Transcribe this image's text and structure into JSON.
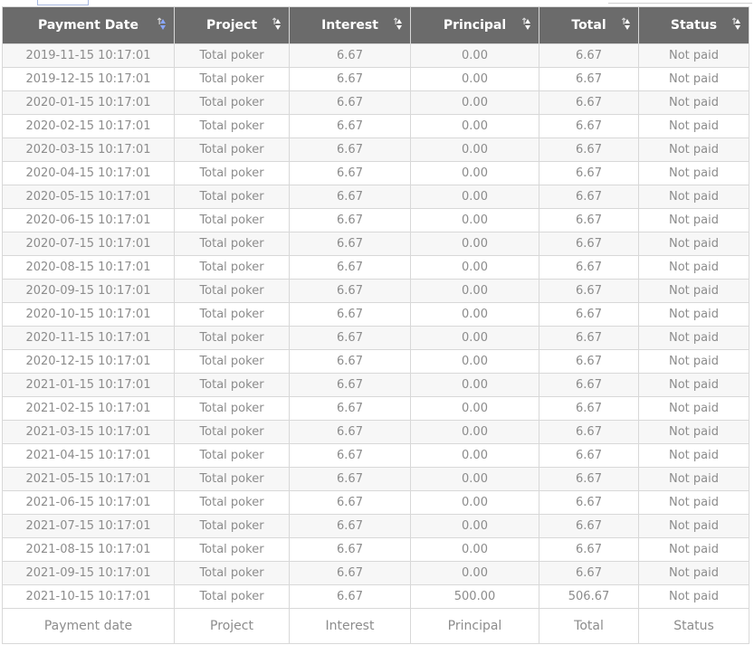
{
  "columns": [
    {
      "label": "Payment Date",
      "sort_active": true
    },
    {
      "label": "Project",
      "sort_active": false
    },
    {
      "label": "Interest",
      "sort_active": false
    },
    {
      "label": "Principal",
      "sort_active": false
    },
    {
      "label": "Total",
      "sort_active": false
    },
    {
      "label": "Status",
      "sort_active": false
    }
  ],
  "rows": [
    [
      "2019-11-15 10:17:01",
      "Total poker",
      "6.67",
      "0.00",
      "6.67",
      "Not paid"
    ],
    [
      "2019-12-15 10:17:01",
      "Total poker",
      "6.67",
      "0.00",
      "6.67",
      "Not paid"
    ],
    [
      "2020-01-15 10:17:01",
      "Total poker",
      "6.67",
      "0.00",
      "6.67",
      "Not paid"
    ],
    [
      "2020-02-15 10:17:01",
      "Total poker",
      "6.67",
      "0.00",
      "6.67",
      "Not paid"
    ],
    [
      "2020-03-15 10:17:01",
      "Total poker",
      "6.67",
      "0.00",
      "6.67",
      "Not paid"
    ],
    [
      "2020-04-15 10:17:01",
      "Total poker",
      "6.67",
      "0.00",
      "6.67",
      "Not paid"
    ],
    [
      "2020-05-15 10:17:01",
      "Total poker",
      "6.67",
      "0.00",
      "6.67",
      "Not paid"
    ],
    [
      "2020-06-15 10:17:01",
      "Total poker",
      "6.67",
      "0.00",
      "6.67",
      "Not paid"
    ],
    [
      "2020-07-15 10:17:01",
      "Total poker",
      "6.67",
      "0.00",
      "6.67",
      "Not paid"
    ],
    [
      "2020-08-15 10:17:01",
      "Total poker",
      "6.67",
      "0.00",
      "6.67",
      "Not paid"
    ],
    [
      "2020-09-15 10:17:01",
      "Total poker",
      "6.67",
      "0.00",
      "6.67",
      "Not paid"
    ],
    [
      "2020-10-15 10:17:01",
      "Total poker",
      "6.67",
      "0.00",
      "6.67",
      "Not paid"
    ],
    [
      "2020-11-15 10:17:01",
      "Total poker",
      "6.67",
      "0.00",
      "6.67",
      "Not paid"
    ],
    [
      "2020-12-15 10:17:01",
      "Total poker",
      "6.67",
      "0.00",
      "6.67",
      "Not paid"
    ],
    [
      "2021-01-15 10:17:01",
      "Total poker",
      "6.67",
      "0.00",
      "6.67",
      "Not paid"
    ],
    [
      "2021-02-15 10:17:01",
      "Total poker",
      "6.67",
      "0.00",
      "6.67",
      "Not paid"
    ],
    [
      "2021-03-15 10:17:01",
      "Total poker",
      "6.67",
      "0.00",
      "6.67",
      "Not paid"
    ],
    [
      "2021-04-15 10:17:01",
      "Total poker",
      "6.67",
      "0.00",
      "6.67",
      "Not paid"
    ],
    [
      "2021-05-15 10:17:01",
      "Total poker",
      "6.67",
      "0.00",
      "6.67",
      "Not paid"
    ],
    [
      "2021-06-15 10:17:01",
      "Total poker",
      "6.67",
      "0.00",
      "6.67",
      "Not paid"
    ],
    [
      "2021-07-15 10:17:01",
      "Total poker",
      "6.67",
      "0.00",
      "6.67",
      "Not paid"
    ],
    [
      "2021-08-15 10:17:01",
      "Total poker",
      "6.67",
      "0.00",
      "6.67",
      "Not paid"
    ],
    [
      "2021-09-15 10:17:01",
      "Total poker",
      "6.67",
      "0.00",
      "6.67",
      "Not paid"
    ],
    [
      "2021-10-15 10:17:01",
      "Total poker",
      "6.67",
      "500.00",
      "506.67",
      "Not paid"
    ]
  ],
  "footer": [
    "Payment date",
    "Project",
    "Interest",
    "Principal",
    "Total",
    "Status"
  ],
  "colors": {
    "header_bg": "#6b6b6b",
    "header_text": "#ffffff",
    "cell_text": "#8c8c8c",
    "sort_active": "#8aa7ff"
  },
  "icons": {
    "sort": "sort-arrows-icon"
  }
}
